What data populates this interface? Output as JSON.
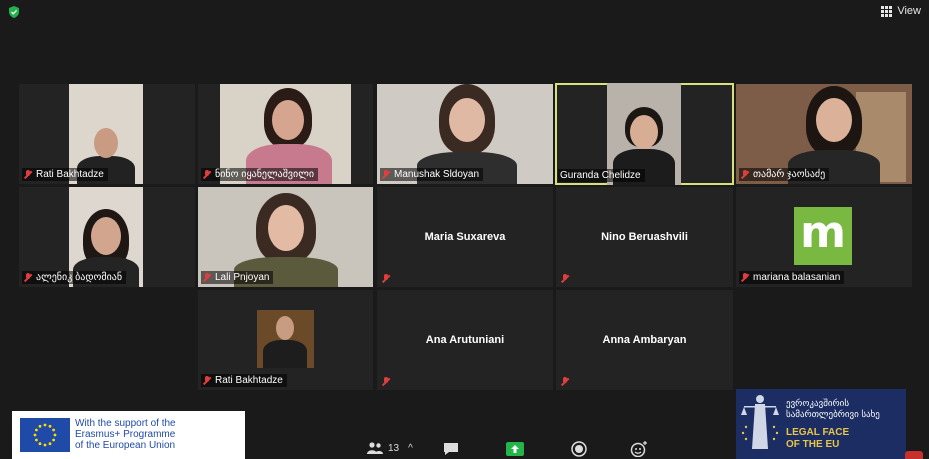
{
  "top_bar": {
    "view_label": "View"
  },
  "participants": [
    {
      "name": "Rati Bakhtadze",
      "muted": true,
      "video": true
    },
    {
      "name": "ნინო იყანელაშვილი",
      "muted": true,
      "video": true
    },
    {
      "name": "Manushak Sldoyan",
      "muted": true,
      "video": true
    },
    {
      "name": "Guranda Chelidze",
      "muted": false,
      "video": true,
      "active_speaker": true
    },
    {
      "name": "თამარ ჯაოსაძე",
      "muted": true,
      "video": true
    },
    {
      "name": "ალენიკ ბადომიან",
      "muted": true,
      "video": true
    },
    {
      "name": "Lali Pnjoyan",
      "muted": true,
      "video": true
    },
    {
      "name": "Maria Suxareva",
      "muted": true,
      "video": false
    },
    {
      "name": "Nino Beruashvili",
      "muted": true,
      "video": false
    },
    {
      "name": "mariana balasanian",
      "muted": true,
      "video": false,
      "avatar_letter": "m"
    },
    {
      "name": "Rati Bakhtadze",
      "muted": true,
      "video": true
    },
    {
      "name": "Ana Arutuniani",
      "muted": true,
      "video": false
    },
    {
      "name": "Anna Ambaryan",
      "muted": true,
      "video": false
    }
  ],
  "toolbar": {
    "participants_count": "13"
  },
  "sponsor_left": {
    "line1": "With the support of the",
    "line2": "Erasmus+ Programme",
    "line3": "of the European Union"
  },
  "sponsor_right": {
    "ka_line1": "ევროკავშირის",
    "ka_line2": "სამართლებრივი სახე",
    "en_line1": "LEGAL FACE",
    "en_line2": "OF THE EU"
  },
  "colors": {
    "background": "#1a1a1a",
    "tile": "#232323",
    "active_speaker_border": "#d7e07a",
    "muted_red": "#e03e3e",
    "avatar_green": "#7ab941",
    "eu_blue": "#1f4aa8",
    "legal_navy": "#1b2d63"
  }
}
